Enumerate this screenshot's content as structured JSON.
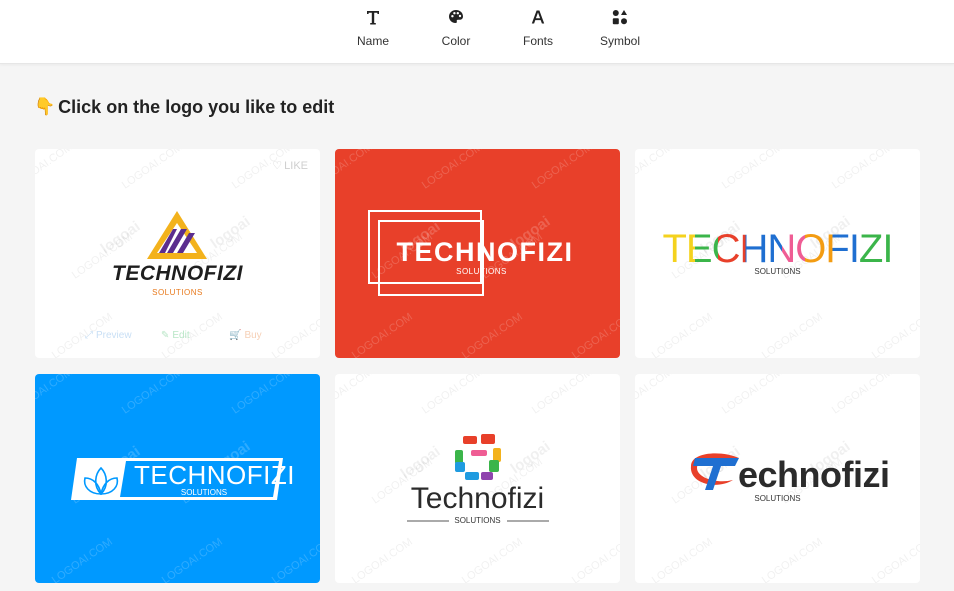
{
  "toolbar": {
    "items": [
      {
        "label": "Name",
        "icon": "text-icon"
      },
      {
        "label": "Color",
        "icon": "palette-icon"
      },
      {
        "label": "Fonts",
        "icon": "font-icon"
      },
      {
        "label": "Symbol",
        "icon": "shapes-icon"
      }
    ]
  },
  "heading": {
    "hand": "👇",
    "text": "Click on the logo you like to edit"
  },
  "watermark": "LOGOAI.COM",
  "watermark_brand": "logoai",
  "colors": {
    "red": "#e8402a",
    "blue": "#0099ff",
    "orange": "#e87a1e",
    "purple": "#5b2d8e",
    "gold": "#f3b21c"
  },
  "cards": [
    {
      "brand": "TECHNOFIZI",
      "tagline": "SOLUTIONS",
      "background": "#ffffff",
      "like": "LIKE",
      "actions": {
        "preview": "Preview",
        "edit": "Edit",
        "buy": "Buy"
      }
    },
    {
      "brand": "TECHNOFIZI",
      "tagline": "SOLUTIONS",
      "background": "#e8402a"
    },
    {
      "brand": "TECHNOFIZI",
      "tagline": "SOLUTIONS",
      "background": "#ffffff"
    },
    {
      "brand": "TECHNOFIZI",
      "tagline": "SOLUTIONS",
      "background": "#0099ff"
    },
    {
      "brand": "Technofizi",
      "tagline": "SOLUTIONS",
      "background": "#ffffff"
    },
    {
      "brand": "echnofizi",
      "brand_initial": "T",
      "tagline": "SOLUTIONS",
      "background": "#ffffff"
    }
  ]
}
